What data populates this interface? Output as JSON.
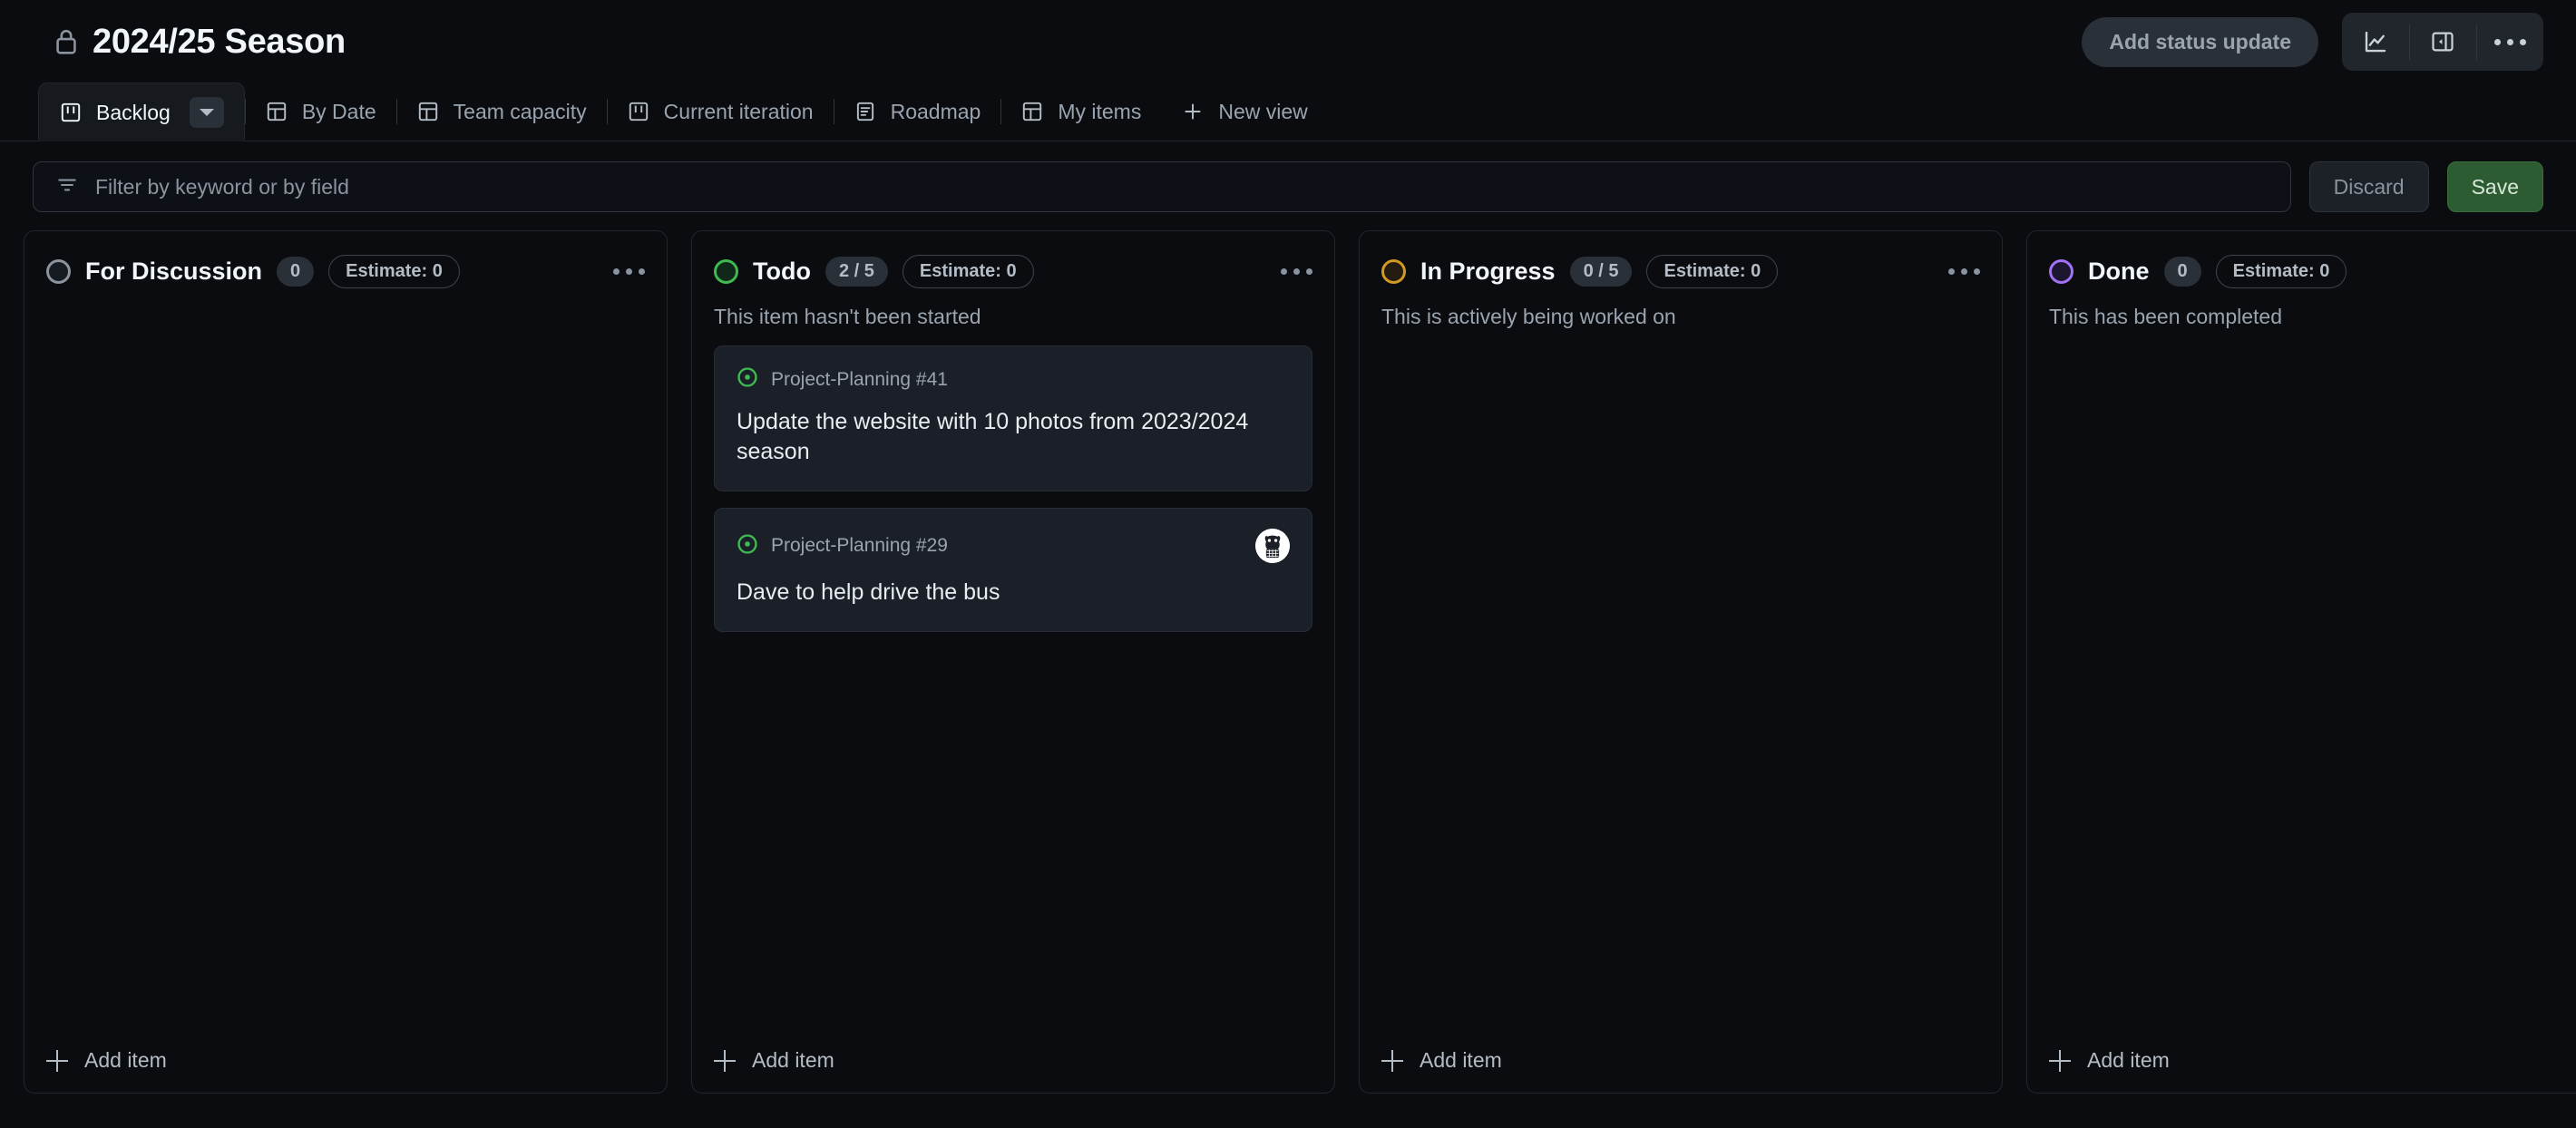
{
  "header": {
    "lock_icon": "lock-icon",
    "title": "2024/25 Season",
    "status_update_label": "Add status update",
    "insights_icon": "line-chart-icon",
    "side_panel_icon": "side-panel-toggle-icon",
    "more_icon": "kebab-menu-icon"
  },
  "tabs": [
    {
      "label": "Backlog",
      "icon": "board-view-icon",
      "active": true,
      "has_dropdown": true
    },
    {
      "label": "By Date",
      "icon": "table-view-icon",
      "active": false,
      "has_dropdown": false
    },
    {
      "label": "Team capacity",
      "icon": "table-view-icon",
      "active": false,
      "has_dropdown": false
    },
    {
      "label": "Current iteration",
      "icon": "board-view-icon",
      "active": false,
      "has_dropdown": false
    },
    {
      "label": "Roadmap",
      "icon": "roadmap-view-icon",
      "active": false,
      "has_dropdown": false
    },
    {
      "label": "My items",
      "icon": "table-view-icon",
      "active": false,
      "has_dropdown": false
    }
  ],
  "new_view": {
    "label": "New view",
    "icon": "plus-icon"
  },
  "filter": {
    "icon": "filter-icon",
    "placeholder": "Filter by keyword or by field",
    "value": "",
    "discard_label": "Discard",
    "save_label": "Save",
    "save_color": "#2d5c32"
  },
  "board": {
    "add_item_label": "Add item",
    "columns": [
      {
        "name": "For Discussion",
        "dot_color": "#8b949e",
        "dot_fill": "#161b22",
        "count": "0",
        "estimate": "Estimate: 0",
        "description": "",
        "cards": []
      },
      {
        "name": "Todo",
        "dot_color": "#3fb950",
        "dot_fill": "#10281a",
        "count": "2 / 5",
        "estimate": "Estimate: 0",
        "description": "This item hasn't been started",
        "cards": [
          {
            "ref": "Project-Planning #41",
            "title": "Update the website with 10 photos from 2023/2024 season",
            "status_icon": "open-issue-icon",
            "has_avatar": false
          },
          {
            "ref": "Project-Planning #29",
            "title": "Dave to help drive the bus",
            "status_icon": "open-issue-icon",
            "has_avatar": true
          }
        ]
      },
      {
        "name": "In Progress",
        "dot_color": "#d29922",
        "dot_fill": "#241c10",
        "count": "0 / 5",
        "estimate": "Estimate: 0",
        "description": "This is actively being worked on",
        "cards": []
      },
      {
        "name": "Done",
        "dot_color": "#a371f7",
        "dot_fill": "#1c1630",
        "count": "0",
        "estimate": "Estimate: 0",
        "description": "This has been completed",
        "cards": []
      }
    ]
  }
}
